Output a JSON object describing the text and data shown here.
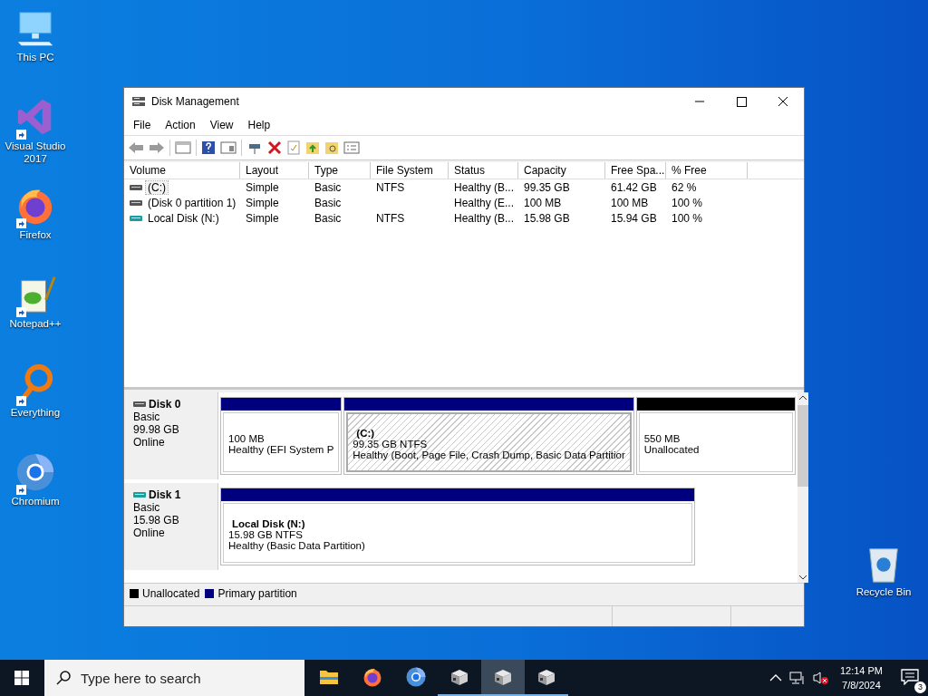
{
  "desktop_icons": [
    {
      "label": "This PC",
      "kind": "pc",
      "shortcut": false
    },
    {
      "label": "Visual Studio 2017",
      "kind": "vs",
      "shortcut": true
    },
    {
      "label": "Firefox",
      "kind": "firefox",
      "shortcut": true
    },
    {
      "label": "Notepad++",
      "kind": "notepad",
      "shortcut": true
    },
    {
      "label": "Everything",
      "kind": "everything",
      "shortcut": true
    },
    {
      "label": "Chromium",
      "kind": "chromium",
      "shortcut": true
    }
  ],
  "recycle_bin": {
    "label": "Recycle Bin"
  },
  "window": {
    "title": "Disk Management",
    "menu": [
      "File",
      "Action",
      "View",
      "Help"
    ],
    "volumes": {
      "columns": [
        "Volume",
        "Layout",
        "Type",
        "File System",
        "Status",
        "Capacity",
        "Free Spa...",
        "% Free"
      ],
      "rows": [
        {
          "kind": "system",
          "selected": true,
          "cells": [
            "(C:)",
            "Simple",
            "Basic",
            "NTFS",
            "Healthy (B...",
            "99.35 GB",
            "61.42 GB",
            "62 %"
          ]
        },
        {
          "kind": "system",
          "selected": false,
          "cells": [
            "(Disk 0 partition 1)",
            "Simple",
            "Basic",
            "",
            "Healthy (E...",
            "100 MB",
            "100 MB",
            "100 %"
          ]
        },
        {
          "kind": "removable",
          "selected": false,
          "cells": [
            "Local Disk (N:)",
            "Simple",
            "Basic",
            "NTFS",
            "Healthy (B...",
            "15.98 GB",
            "15.94 GB",
            "100 %"
          ]
        }
      ]
    },
    "disks": [
      {
        "name": "Disk 0",
        "kind": "system",
        "type": "Basic",
        "size": "99.98 GB",
        "status": "Online",
        "partitions": [
          {
            "kind": "primary",
            "selected": false,
            "lines": [
              "100 MB",
              "Healthy (EFI System P"
            ]
          },
          {
            "kind": "primary",
            "selected": true,
            "label": "(C:)",
            "lines": [
              "99.35 GB NTFS",
              "Healthy (Boot, Page File, Crash Dump, Basic Data Partitior"
            ]
          },
          {
            "kind": "unallocated",
            "selected": false,
            "lines": [
              "550 MB",
              "Unallocated"
            ]
          }
        ]
      },
      {
        "name": "Disk 1",
        "kind": "removable",
        "type": "Basic",
        "size": "15.98 GB",
        "status": "Online",
        "partitions": [
          {
            "kind": "primary",
            "selected": false,
            "label": "Local Disk  (N:)",
            "lines": [
              "15.98 GB NTFS",
              "Healthy (Basic Data Partition)"
            ]
          }
        ]
      }
    ],
    "legend": [
      {
        "label": "Unallocated",
        "color": "#000000"
      },
      {
        "label": "Primary partition",
        "color": "#00007f"
      }
    ]
  },
  "taskbar": {
    "search": {
      "placeholder": "Type here to search"
    },
    "apps": [
      {
        "kind": "explorer",
        "selected": false
      },
      {
        "kind": "firefox",
        "selected": false
      },
      {
        "kind": "chromium",
        "selected": false
      },
      {
        "kind": "disk",
        "selected": false
      },
      {
        "kind": "disk",
        "selected": true
      },
      {
        "kind": "disk",
        "selected": false
      }
    ],
    "time": "12:14 PM",
    "date": "7/8/2024",
    "notifications": "3"
  }
}
